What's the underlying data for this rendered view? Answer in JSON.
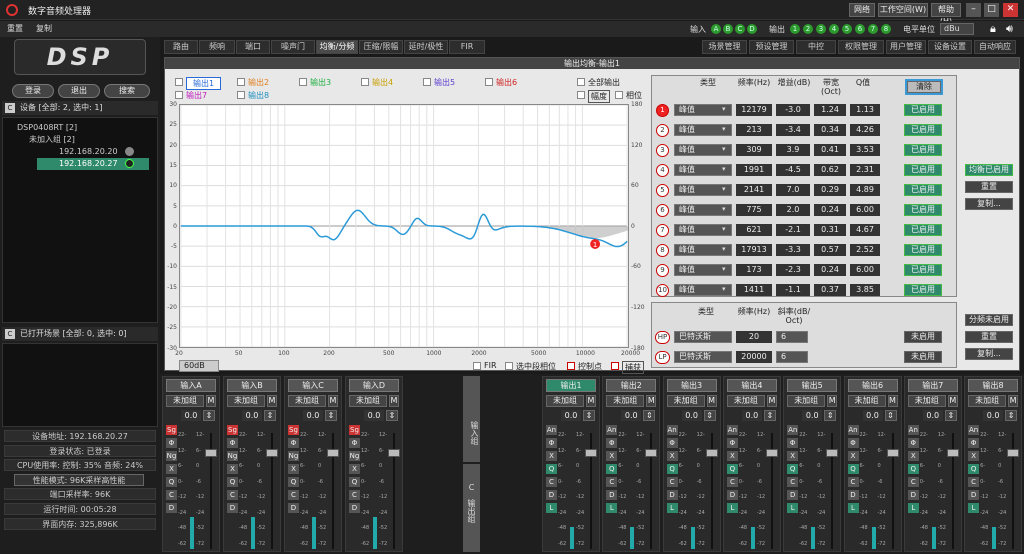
{
  "app": {
    "title": "数字音频处理器"
  },
  "titlebar": {
    "network": "网络",
    "workspace": "工作空间(W)",
    "help": "帮助(H)"
  },
  "menu": {
    "items": [
      "重置",
      "复制"
    ]
  },
  "io": {
    "input_label": "输入",
    "inputs": [
      "A",
      "B",
      "C",
      "D"
    ],
    "output_label": "输出",
    "outputs": [
      "1",
      "2",
      "3",
      "4",
      "5",
      "6",
      "7",
      "8"
    ],
    "level_unit_label": "电平单位",
    "level_unit": "dBu"
  },
  "left": {
    "logo": "DSP",
    "login": "登录",
    "logout": "退出",
    "search": "搜索",
    "devices_header": "设备 [全部: 2, 选中: 1]",
    "tree": [
      "DSP0408RT [2]",
      "未加入组 [2]",
      "192.168.20.20",
      "192.168.20.27"
    ],
    "scenes_header": "已打开场景 [全部: 0, 选中: 0]",
    "info": [
      "设备地址: 192.168.20.27",
      "登录状态: 已登录",
      "CPU使用率: 控制: 35% 音频: 24%",
      "性能模式: 96K采样高性能",
      "端口采样率: 96K",
      "运行时间: 00:05:28",
      "界面内存: 325,896K"
    ]
  },
  "tabs": [
    "路由",
    "频响",
    "端口",
    "噪声门",
    "均衡/分频",
    "压缩/限幅",
    "延时/极性",
    "FIR"
  ],
  "tabs_right": [
    "场景管理",
    "预设管理",
    "中控",
    "权限管理",
    "用户管理",
    "设备设置",
    "自动响应"
  ],
  "eq": {
    "panel_title": "输出均衡-输出1",
    "legend": [
      {
        "label": "输出1",
        "color": "#2a6ad8"
      },
      {
        "label": "输出2",
        "color": "#e08020"
      },
      {
        "label": "输出3",
        "color": "#20b040"
      },
      {
        "label": "输出4",
        "color": "#c8a000"
      },
      {
        "label": "输出5",
        "color": "#6040d0"
      },
      {
        "label": "输出6",
        "color": "#d02020"
      },
      {
        "label": "输出7",
        "color": "#c020c0"
      },
      {
        "label": "输出8",
        "color": "#2090c0"
      }
    ],
    "all_outputs": "全部输出",
    "amplitude": "幅度",
    "phase": "相位",
    "range": "60dB",
    "fir": "FIR",
    "sel_phase": "选中段相位",
    "ctrl_point": "控制点",
    "capture": "捕获",
    "y_left": [
      "30",
      "25",
      "20",
      "15",
      "10",
      "5",
      "0",
      "-5",
      "-10",
      "-15",
      "-20",
      "-25",
      "-30"
    ],
    "y_right": [
      "180",
      "120",
      "60",
      "0",
      "-60",
      "-120",
      "-180"
    ],
    "x_ticks": [
      "20",
      "50",
      "100",
      "200",
      "500",
      "1000",
      "2000",
      "5000",
      "10000",
      "20000"
    ],
    "col_headers": [
      "类型",
      "频率(Hz)",
      "增益(dB)",
      "带宽\n(Oct)",
      "Q值"
    ],
    "clear": "清除",
    "bands": [
      {
        "n": "1",
        "type": "峰值",
        "freq": "12179",
        "gain": "-3.0",
        "bw": "1.24",
        "q": "1.13",
        "state": "已启用"
      },
      {
        "n": "2",
        "type": "峰值",
        "freq": "213",
        "gain": "-3.4",
        "bw": "0.34",
        "q": "4.26",
        "state": "已启用"
      },
      {
        "n": "3",
        "type": "峰值",
        "freq": "309",
        "gain": "3.9",
        "bw": "0.41",
        "q": "3.53",
        "state": "已启用"
      },
      {
        "n": "4",
        "type": "峰值",
        "freq": "1991",
        "gain": "-4.5",
        "bw": "0.62",
        "q": "2.31",
        "state": "已启用"
      },
      {
        "n": "5",
        "type": "峰值",
        "freq": "2141",
        "gain": "7.0",
        "bw": "0.29",
        "q": "4.89",
        "state": "已启用"
      },
      {
        "n": "6",
        "type": "峰值",
        "freq": "775",
        "gain": "2.0",
        "bw": "0.24",
        "q": "6.00",
        "state": "已启用"
      },
      {
        "n": "7",
        "type": "峰值",
        "freq": "621",
        "gain": "-2.1",
        "bw": "0.31",
        "q": "4.67",
        "state": "已启用"
      },
      {
        "n": "8",
        "type": "峰值",
        "freq": "17913",
        "gain": "-3.3",
        "bw": "0.57",
        "q": "2.52",
        "state": "已启用"
      },
      {
        "n": "9",
        "type": "峰值",
        "freq": "173",
        "gain": "-2.3",
        "bw": "0.24",
        "q": "6.00",
        "state": "已启用"
      },
      {
        "n": "10",
        "type": "峰值",
        "freq": "1411",
        "gain": "-1.1",
        "bw": "0.37",
        "q": "3.85",
        "state": "已启用"
      }
    ],
    "side_buttons": [
      "均衡已启用",
      "重置",
      "复制..."
    ],
    "xo_headers": [
      "类型",
      "频率(Hz)",
      "斜率(dB/\nOct)"
    ],
    "xo": [
      {
        "n": "HP",
        "type": "巴特沃斯",
        "freq": "20",
        "slope": "6",
        "state": "未启用"
      },
      {
        "n": "LP",
        "type": "巴特沃斯",
        "freq": "20000",
        "slope": "6",
        "state": "未启用"
      }
    ],
    "xo_buttons": [
      "分频未启用",
      "重置",
      "复制..."
    ]
  },
  "strips": {
    "inputs": [
      "输入A",
      "输入B",
      "输入C",
      "输入D"
    ],
    "outputs": [
      "输出1",
      "输出2",
      "输出3",
      "输出4",
      "输出5",
      "输出6",
      "输出7",
      "输出8"
    ],
    "group": "未加组",
    "m": "M",
    "level": "0.0",
    "in_btns": [
      "Sg",
      "Φ",
      "Ng",
      "X",
      "Q",
      "C",
      "D"
    ],
    "out_btns": [
      "An",
      "Φ",
      "X",
      "Q",
      "C",
      "D",
      "L"
    ],
    "scale": [
      "22-",
      "12-",
      "6-",
      "0-",
      "-12",
      "-24",
      "-48",
      "-62"
    ],
    "scale2": [
      "12-",
      "6-",
      "0",
      "-6",
      "-12",
      "-24",
      "-52",
      "-72"
    ],
    "in_group": "输入组",
    "out_group": "输出组",
    "c_label": "C"
  }
}
